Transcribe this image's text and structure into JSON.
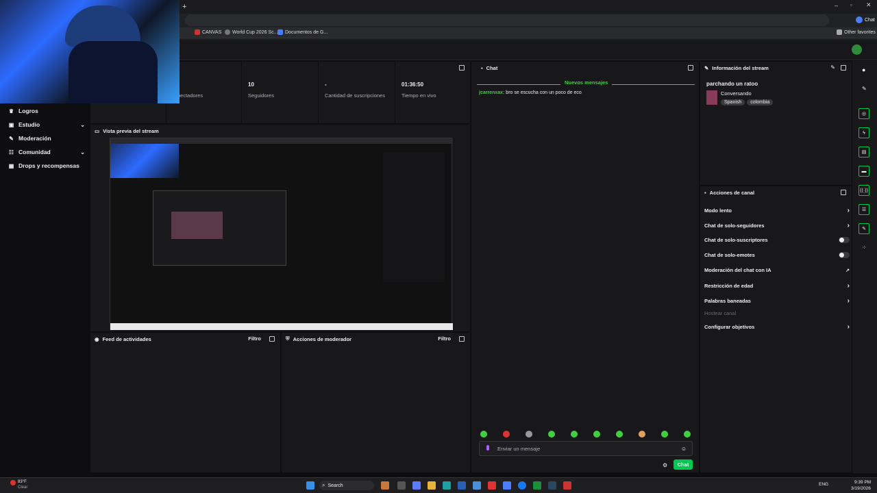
{
  "browser": {
    "bookmarks": [
      "CANVAS",
      "World Cup 2026 Sc...",
      "Documentos de G..."
    ],
    "other_favorites": "Other favorites",
    "chat_profile": "Chat"
  },
  "sidebar": {
    "items": [
      {
        "label": "Logros",
        "icon": "trophy-icon",
        "has_chevron": false
      },
      {
        "label": "Estudio",
        "icon": "camera-icon",
        "has_chevron": true
      },
      {
        "label": "Moderación",
        "icon": "wrench-icon",
        "has_chevron": false
      },
      {
        "label": "Comunidad",
        "icon": "people-icon",
        "has_chevron": true
      },
      {
        "label": "Drops y recompensas",
        "icon": "gift-icon",
        "has_chevron": false
      }
    ]
  },
  "stats": {
    "spectators_label": "pectadores",
    "followers_value": "10",
    "followers_label": "Seguidores",
    "subs_value": "-",
    "subs_label": "Cantidad de suscripciones",
    "time_value": "01:36:50",
    "time_label": "Tiempo en vivo"
  },
  "preview": {
    "title": "Vista previa del stream"
  },
  "activity_feed": {
    "title": "Feed de actividades",
    "filter": "Filtro"
  },
  "mod_actions": {
    "title": "Acciones de moderador",
    "filter": "Filtro"
  },
  "chat": {
    "title": "Chat",
    "new_messages": "Nuevos mensajes",
    "messages": [
      {
        "user": "jcarrenxax:",
        "text": " bro se escucha con un poco de eco"
      }
    ],
    "input_placeholder": "Enviar un mensaje",
    "send_label": "Chat"
  },
  "stream_info": {
    "title": "Información del stream",
    "stream_title": "parchando un ratoo",
    "category": "Conversando",
    "tags": [
      "Spanish",
      "colombia"
    ]
  },
  "channel_actions": {
    "title": "Acciones de canal",
    "items": [
      {
        "label": "Modo lento",
        "control": "chevron"
      },
      {
        "label": "Chat de solo-seguidores",
        "control": "chevron"
      },
      {
        "label": "Chat de solo-suscriptores",
        "control": "toggle"
      },
      {
        "label": "Chat de solo-emotes",
        "control": "toggle"
      },
      {
        "label": "Moderación del chat con IA",
        "control": "external"
      },
      {
        "label": "Restricción de edad",
        "control": "chevron"
      },
      {
        "label": "Palabras baneadas",
        "control": "chevron"
      },
      {
        "label": "Hostear canal",
        "control": "disabled"
      },
      {
        "label": "Configurar objetivos",
        "control": "chevron"
      }
    ]
  },
  "taskbar": {
    "weather_temp": "83°F",
    "weather_desc": "Clear",
    "search": "Search",
    "lang": "ENG",
    "time": "9:39 PM",
    "date": "3/19/2026"
  },
  "colors": {
    "accent": "#00c853",
    "chat_user": "#3fcf3f",
    "bg": "#0e0e10",
    "panel": "#18181b"
  }
}
